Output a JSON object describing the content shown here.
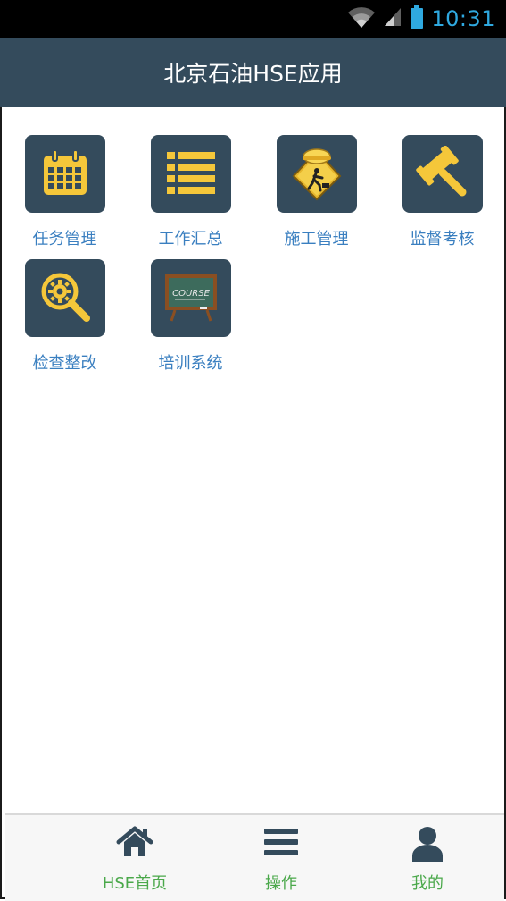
{
  "status_bar": {
    "time": "10:31",
    "icons": [
      "wifi-icon",
      "signal-icon",
      "battery-icon"
    ]
  },
  "app_bar": {
    "title": "北京石油HSE应用"
  },
  "modules": [
    {
      "label": "任务管理",
      "icon": "calendar-icon"
    },
    {
      "label": "工作汇总",
      "icon": "list-icon"
    },
    {
      "label": "施工管理",
      "icon": "construction-worker-icon"
    },
    {
      "label": "监督考核",
      "icon": "gavel-icon"
    },
    {
      "label": "检查整改",
      "icon": "magnifier-gear-icon"
    },
    {
      "label": "培训系统",
      "icon": "course-blackboard-icon"
    }
  ],
  "bottom_nav": [
    {
      "label": "HSE首页",
      "icon": "home-icon"
    },
    {
      "label": "操作",
      "icon": "menu-icon"
    },
    {
      "label": "我的",
      "icon": "user-icon"
    }
  ],
  "colors": {
    "header_bg": "#344b5c",
    "tile_bg": "#344b5c",
    "accent_yellow": "#f5c73a",
    "label_blue": "#3a7fc0",
    "nav_label_green": "#4aa84a",
    "clock_blue": "#2fa9e0"
  }
}
